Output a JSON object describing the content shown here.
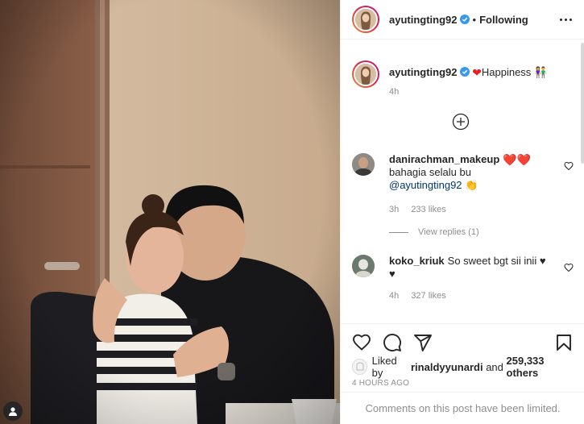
{
  "header": {
    "username": "ayutingting92",
    "separator": "•",
    "follow_status": "Following"
  },
  "caption": {
    "username": "ayutingting92",
    "text": "Happiness",
    "heart_glyph": "❤",
    "emoji_glyph": "👫",
    "time": "4h"
  },
  "comments": [
    {
      "username": "danirachman_makeup",
      "hearts": "❤️❤️",
      "text": "bahagia selalu bu",
      "mention": "@ayutingting92",
      "emoji": "👏",
      "time": "3h",
      "likes": "233 likes",
      "view_replies": "View replies (1)"
    },
    {
      "username": "koko_kriuk",
      "text": "So sweet bgt sii inii",
      "hearts": "♥",
      "hearts2": "♥",
      "time": "4h",
      "likes": "327 likes"
    }
  ],
  "likes": {
    "prefix": "Liked by",
    "user": "rinaldyyunardi",
    "joiner": "and",
    "count": "259,333 others"
  },
  "post_time": "4 HOURS AGO",
  "comments_limited": "Comments on this post have been limited.",
  "colors": {
    "verified_blue": "#3897f0",
    "heart_red": "#ed1c24",
    "muted_gray": "#8e8e8e",
    "mention_blue": "#00376b"
  },
  "icons": [
    "user-tag-icon",
    "more-options-icon",
    "verified-badge-icon",
    "load-more-comments-icon",
    "like-icon",
    "comment-icon",
    "share-icon",
    "save-icon",
    "comment-like-icon"
  ]
}
